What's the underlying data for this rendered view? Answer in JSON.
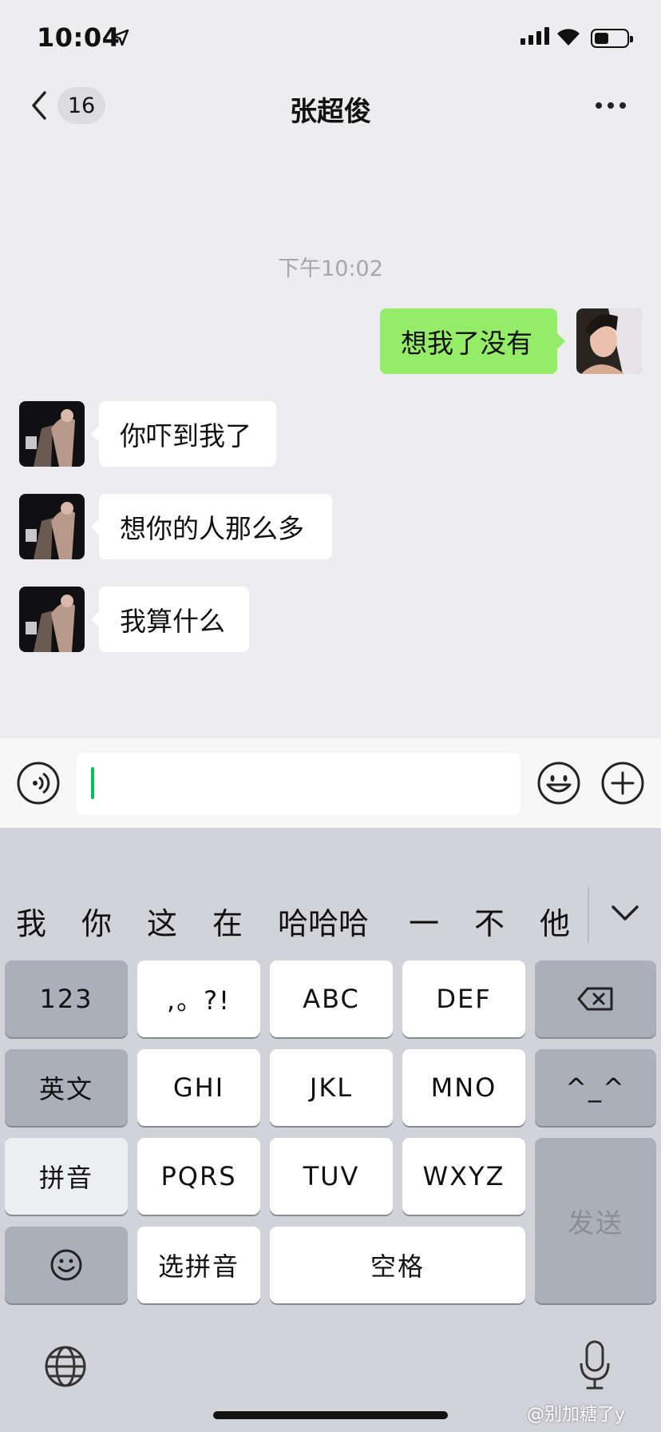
{
  "status_bar": {
    "time": "10:04"
  },
  "nav": {
    "unread_count": "16",
    "title": "张超俊"
  },
  "chat": {
    "timestamp": "下午10:02",
    "messages": [
      {
        "from": "me",
        "text": "想我了没有"
      },
      {
        "from": "contact",
        "text": "你吓到我了"
      },
      {
        "from": "contact",
        "text": "想你的人那么多"
      },
      {
        "from": "contact",
        "text": "我算什么"
      }
    ]
  },
  "keyboard": {
    "candidates": [
      "我",
      "你",
      "这",
      "在",
      "哈哈哈",
      "一",
      "不",
      "他"
    ],
    "keys": {
      "num": "123",
      "punct": ",。?!",
      "abc": "ABC",
      "def": "DEF",
      "english": "英文",
      "ghi": "GHI",
      "jkl": "JKL",
      "mno": "MNO",
      "emoticon": "^_^",
      "pinyin": "拼音",
      "pqrs": "PQRS",
      "tuv": "TUV",
      "wxyz": "WXYZ",
      "send": "发送",
      "select_pinyin": "选拼音",
      "space": "空格"
    }
  },
  "watermark": "@别加糖了y",
  "colors": {
    "outgoing_bubble": "#95ec69",
    "caret": "#07c160",
    "background": "#ededf0"
  }
}
